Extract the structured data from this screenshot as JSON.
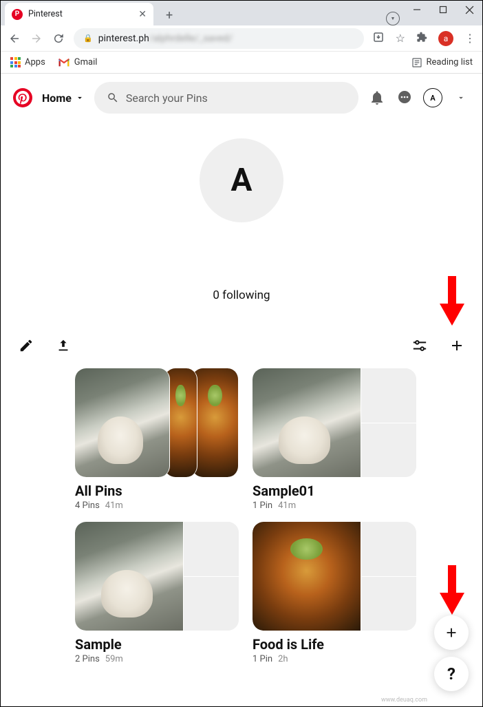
{
  "browser": {
    "tab_title": "Pinterest",
    "url_host": "pinterest.ph",
    "url_path": "/alphrdelle/_saved/",
    "bookmarks": {
      "apps": "Apps",
      "gmail": "Gmail",
      "reading_list": "Reading list"
    },
    "profile_letter": "a"
  },
  "header": {
    "home_label": "Home",
    "search_placeholder": "Search your Pins",
    "profile_initial": "A"
  },
  "profile": {
    "avatar_initial": "A",
    "following_text": "0 following"
  },
  "boards": [
    {
      "title": "All Pins",
      "pins": "4 Pins",
      "time": "41m",
      "type": "stacked"
    },
    {
      "title": "Sample01",
      "pins": "1 Pin",
      "time": "41m",
      "type": "dog"
    },
    {
      "title": "Sample",
      "pins": "2 Pins",
      "time": "59m",
      "type": "dog"
    },
    {
      "title": "Food is Life",
      "pins": "1 Pin",
      "time": "2h",
      "type": "food"
    }
  ],
  "fab": {
    "add": "+",
    "help": "?"
  },
  "watermark": "www.deuaq.com"
}
